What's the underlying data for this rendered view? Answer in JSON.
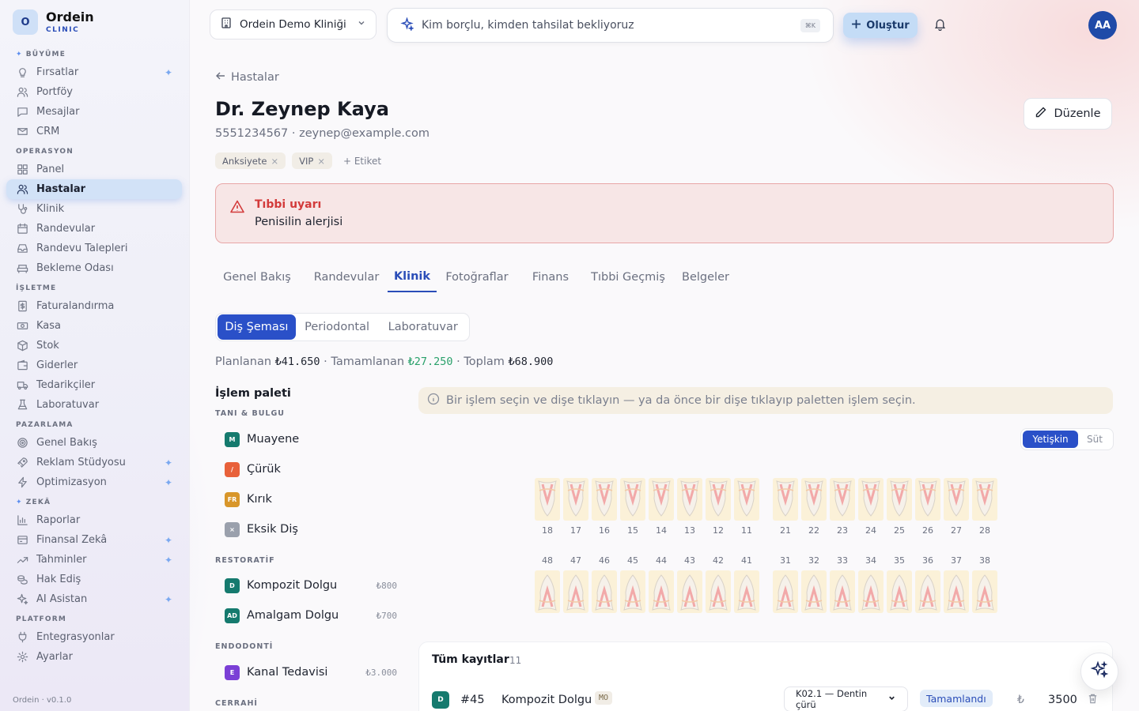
{
  "brand": {
    "logo": "O",
    "name": "Ordein",
    "sub": "CLINIC"
  },
  "sidebar": {
    "sections": [
      {
        "label": "BÜYÜME",
        "spark": true
      },
      {
        "label": "OPERASYON"
      },
      {
        "label": "İŞLETME"
      },
      {
        "label": "PAZARLAMA"
      },
      {
        "label": "ZEKÂ",
        "spark": true
      },
      {
        "label": "PLATFORM"
      }
    ],
    "items": [
      {
        "label": "Fırsatlar",
        "icon": "lightbulb-icon",
        "star": true
      },
      {
        "label": "Portföy",
        "icon": "users-icon"
      },
      {
        "label": "Mesajlar",
        "icon": "message-icon"
      },
      {
        "label": "CRM",
        "icon": "chat-icon"
      },
      {
        "label": "Panel",
        "icon": "grid-icon"
      },
      {
        "label": "Hastalar",
        "icon": "patients-icon",
        "active": true
      },
      {
        "label": "Klinik",
        "icon": "stethoscope-icon"
      },
      {
        "label": "Randevular",
        "icon": "calendar-icon"
      },
      {
        "label": "Randevu Talepleri",
        "icon": "inbox-icon"
      },
      {
        "label": "Bekleme Odası",
        "icon": "sofa-icon"
      },
      {
        "label": "Faturalandırma",
        "icon": "invoice-icon"
      },
      {
        "label": "Kasa",
        "icon": "cash-icon"
      },
      {
        "label": "Stok",
        "icon": "box-icon"
      },
      {
        "label": "Giderler",
        "icon": "wallet-icon"
      },
      {
        "label": "Tedarikçiler",
        "icon": "truck-icon"
      },
      {
        "label": "Laboratuvar",
        "icon": "flask-icon"
      },
      {
        "label": "Genel Bakış",
        "icon": "target-icon"
      },
      {
        "label": "Reklam Stüdyosu",
        "icon": "rocket-icon",
        "star": true
      },
      {
        "label": "Optimizasyon",
        "icon": "bolt-icon",
        "star": true
      },
      {
        "label": "Raporlar",
        "icon": "bar-chart-icon"
      },
      {
        "label": "Finansal Zekâ",
        "icon": "finance-icon",
        "star": true
      },
      {
        "label": "Tahminler",
        "icon": "trend-icon",
        "star": true
      },
      {
        "label": "Hak Ediş",
        "icon": "coins-icon"
      },
      {
        "label": "AI Asistan",
        "icon": "sparkle-icon",
        "star": true
      },
      {
        "label": "Entegrasyonlar",
        "icon": "plug-icon"
      },
      {
        "label": "Ayarlar",
        "icon": "gear-icon"
      }
    ],
    "version": "Ordein · v0.1.0"
  },
  "topbar": {
    "clinic": "Ordein Demo Kliniği",
    "search_placeholder": "Kim borçlu, kimden tahsilat bekliyoruz",
    "shortcut": "⌘K",
    "create": "Oluştur",
    "avatar": "AA"
  },
  "patient": {
    "back": "Hastalar",
    "name": "Dr. Zeynep Kaya",
    "contact": "5551234567 · zeynep@example.com",
    "tags": [
      "Anksiyete",
      "VIP"
    ],
    "add_tag": "+ Etiket",
    "edit": "Düzenle"
  },
  "alert": {
    "title": "Tıbbi uyarı",
    "body": "Penisilin alerjisi",
    "color": "#d33b3b"
  },
  "tabs": [
    "Genel Bakış",
    "Randevular",
    "Klinik",
    "Fotoğraflar",
    "Finans",
    "Tıbbi Geçmiş",
    "Belgeler"
  ],
  "active_tab": "Klinik",
  "subtabs": [
    "Diş Şeması",
    "Periodontal",
    "Laboratuvar"
  ],
  "active_subtab": "Diş Şeması",
  "totals": {
    "planned_label": "Planlanan",
    "planned": "₺41.650",
    "done_label": "Tamamlanan",
    "done": "₺27.250",
    "total_label": "Toplam",
    "total": "₺68.900"
  },
  "palette": {
    "title": "İşlem paleti",
    "groups": [
      {
        "label": "TANI & BULGU",
        "items": [
          {
            "badge": "M",
            "label": "Muayene",
            "color": "#157a6e"
          },
          {
            "badge": "/",
            "label": "Çürük",
            "color": "#e8613a"
          },
          {
            "badge": "FR",
            "label": "Kırık",
            "color": "#d8962a"
          },
          {
            "badge": "×",
            "label": "Eksik Diş",
            "color": "#9aa0ac"
          }
        ]
      },
      {
        "label": "RESTORATİF",
        "items": [
          {
            "badge": "D",
            "label": "Kompozit Dolgu",
            "price": "₺800",
            "color": "#157a6e"
          },
          {
            "badge": "AD",
            "label": "Amalgam Dolgu",
            "price": "₺700",
            "color": "#157a6e"
          }
        ]
      },
      {
        "label": "ENDODONTİ",
        "items": [
          {
            "badge": "E",
            "label": "Kanal Tedavisi",
            "price": "₺3.000",
            "color": "#7b3fd6"
          }
        ]
      },
      {
        "label": "CERRAHİ",
        "items": []
      }
    ]
  },
  "hint": "Bir işlem seçin ve dişe tıklayın — ya da önce bir dişe tıklayıp paletten işlem seçin.",
  "dentition": {
    "options": [
      "Yetişkin",
      "Süt"
    ],
    "active": "Yetişkin"
  },
  "teeth": {
    "upper": [
      "18",
      "17",
      "16",
      "15",
      "14",
      "13",
      "12",
      "11",
      "21",
      "22",
      "23",
      "24",
      "25",
      "26",
      "27",
      "28"
    ],
    "lower": [
      "48",
      "47",
      "46",
      "45",
      "44",
      "43",
      "42",
      "41",
      "31",
      "32",
      "33",
      "34",
      "35",
      "36",
      "37",
      "38"
    ]
  },
  "records": {
    "title": "Tüm kayıtlar",
    "count": "11",
    "rows": [
      {
        "badge": "D",
        "id": "#45",
        "procedure": "Kompozit Dolgu",
        "surface": "MO",
        "diagnosis": "K02.1 — Dentin çürü",
        "status": "Tamamlandı",
        "currency": "₺",
        "amount": "3500"
      }
    ]
  }
}
